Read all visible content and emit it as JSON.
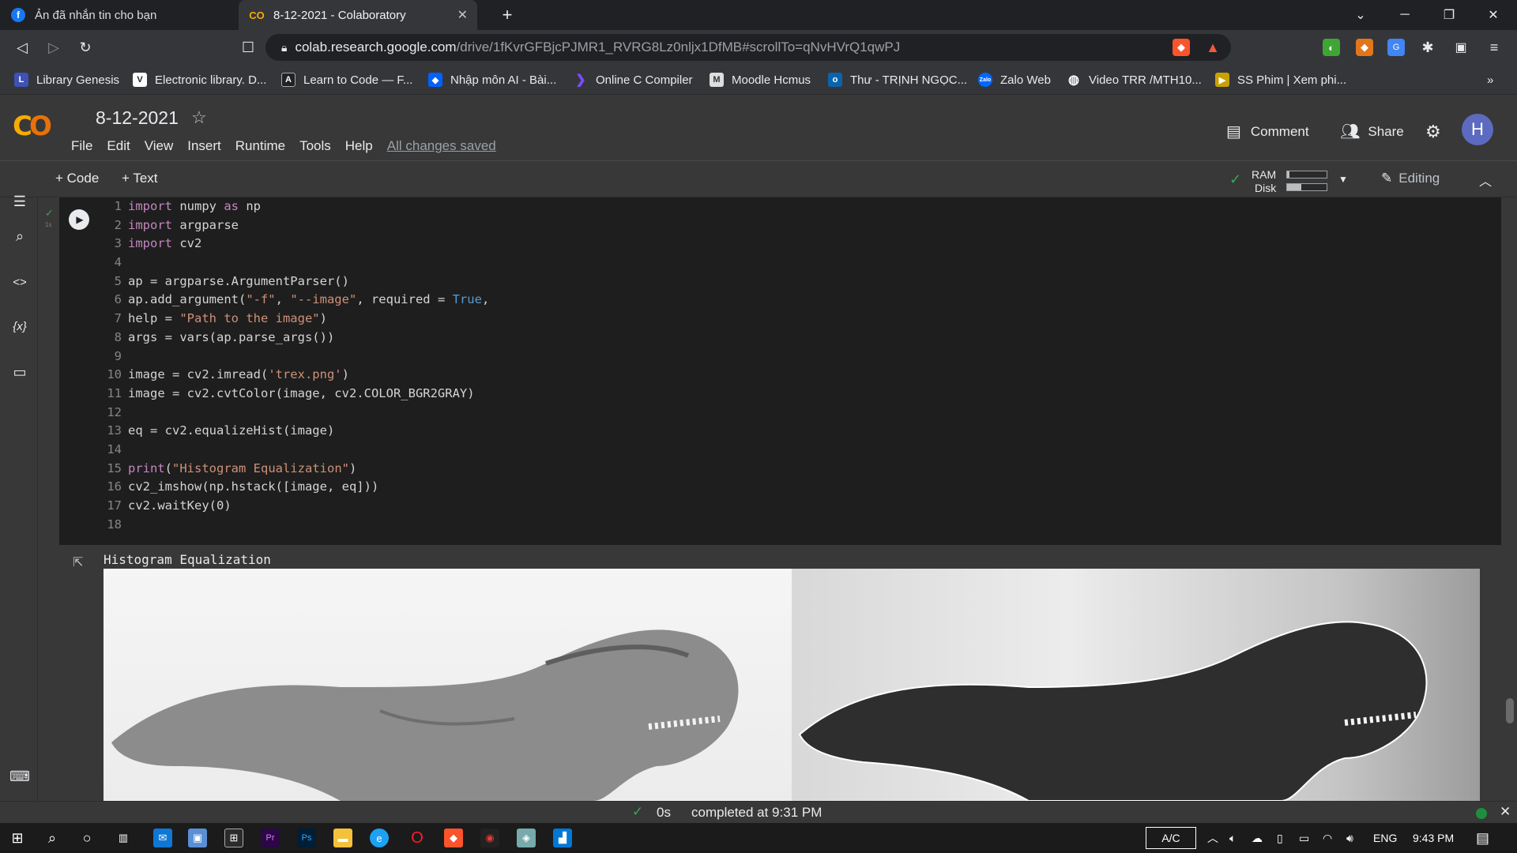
{
  "browser": {
    "tabs": [
      {
        "title": "Ản đã nhắn tin cho bạn",
        "icon": "facebook-icon"
      },
      {
        "title": "8-12-2021 - Colaboratory",
        "icon": "colab-icon"
      }
    ],
    "url_host": "colab.research.google.com",
    "url_path": "/drive/1fKvrGFBjcPJMR1_RVRG8Lz0nljx1DfMB#scrollTo=qNvHVrQ1qwPJ",
    "bookmarks": [
      "Library Genesis",
      "Electronic library. D...",
      "Learn to Code — F...",
      "Nhập môn AI - Bài...",
      "Online C Compiler",
      "Moodle Hcmus",
      "Thư - TRỊNH NGỌC...",
      "Zalo Web",
      "Video TRR /MTH10...",
      "SS Phim | Xem phi..."
    ]
  },
  "colab": {
    "title": "8-12-2021",
    "menus": [
      "File",
      "Edit",
      "View",
      "Insert",
      "Runtime",
      "Tools",
      "Help"
    ],
    "saved_status": "All changes saved",
    "comment_label": "Comment",
    "share_label": "Share",
    "avatar_letter": "H",
    "add_code": "+ Code",
    "add_text": "+ Text",
    "ram_label": "RAM",
    "disk_label": "Disk",
    "ram_fraction": 0.05,
    "disk_fraction": 0.35,
    "editing_label": "Editing"
  },
  "cell": {
    "exec_time": "1s",
    "code": [
      [
        [
          "kw",
          "import"
        ],
        [
          "tx",
          " numpy "
        ],
        [
          "kw",
          "as"
        ],
        [
          "tx",
          " np"
        ]
      ],
      [
        [
          "kw",
          "import"
        ],
        [
          "tx",
          " argparse"
        ]
      ],
      [
        [
          "kw",
          "import"
        ],
        [
          "tx",
          " cv2"
        ]
      ],
      [],
      [
        [
          "tx",
          "ap = argparse.ArgumentParser()"
        ]
      ],
      [
        [
          "tx",
          "ap.add_argument("
        ],
        [
          "st",
          "\"-f\""
        ],
        [
          "tx",
          ", "
        ],
        [
          "st",
          "\"--image\""
        ],
        [
          "tx",
          ", required = "
        ],
        [
          "bt",
          "True"
        ],
        [
          "tx",
          ","
        ]
      ],
      [
        [
          "tx",
          "help = "
        ],
        [
          "st",
          "\"Path to the image\""
        ],
        [
          "tx",
          ")"
        ]
      ],
      [
        [
          "tx",
          "args = vars(ap.parse_args())"
        ]
      ],
      [],
      [
        [
          "tx",
          "image = cv2.imread("
        ],
        [
          "st",
          "'trex.png'"
        ],
        [
          "tx",
          ")"
        ]
      ],
      [
        [
          "tx",
          "image = cv2.cvtColor(image, cv2.COLOR_BGR2GRAY)"
        ]
      ],
      [],
      [
        [
          "tx",
          "eq = cv2.equalizeHist(image)"
        ]
      ],
      [],
      [
        [
          "kw",
          "print"
        ],
        [
          "tx",
          "("
        ],
        [
          "st",
          "\"Histogram Equalization\""
        ],
        [
          "tx",
          ")"
        ]
      ],
      [
        [
          "tx",
          "cv2_imshow(np.hstack([image, eq]))"
        ]
      ],
      [
        [
          "tx",
          "cv2.waitKey(0)"
        ]
      ],
      []
    ],
    "output_text": "Histogram Equalization"
  },
  "status": {
    "duration": "0s",
    "completed": "completed at 9:31 PM"
  },
  "taskbar": {
    "ac_label": "A/C",
    "lang": "ENG",
    "time": "9:43 PM"
  }
}
